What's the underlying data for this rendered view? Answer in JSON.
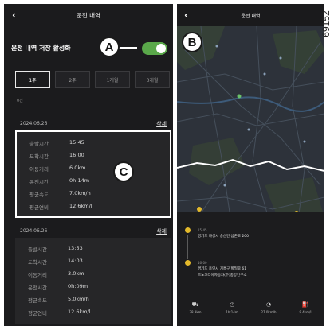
{
  "left": {
    "title": "운전 내역",
    "back_icon": "‹",
    "setting_label": "운전 내역 저장 활성화",
    "toggle_on": true,
    "toggle_color": "#5aa84a",
    "periods": [
      "1주",
      "2주",
      "1개월",
      "3개월"
    ],
    "selected_period": "1주",
    "note": "0건",
    "records": [
      {
        "date": "2024.06.26",
        "delete": "삭제",
        "rows": [
          {
            "k": "출발시간",
            "v": "15:45"
          },
          {
            "k": "도착시간",
            "v": "16:00"
          },
          {
            "k": "이동거리",
            "v": "6.0km"
          },
          {
            "k": "운전시간",
            "v": "0h:14m"
          },
          {
            "k": "평균속도",
            "v": "7.0km/h"
          },
          {
            "k": "평균연비",
            "v": "12.6km/l"
          }
        ]
      },
      {
        "date": "2024.06.26",
        "delete": "삭제",
        "rows": [
          {
            "k": "출발시간",
            "v": "13:53"
          },
          {
            "k": "도착시간",
            "v": "14:03"
          },
          {
            "k": "이동거리",
            "v": "3.0km"
          },
          {
            "k": "운전시간",
            "v": "0h:09m"
          },
          {
            "k": "평균속도",
            "v": "5.0km/h"
          },
          {
            "k": "평균연비",
            "v": "12.6km/l"
          }
        ]
      }
    ]
  },
  "right": {
    "title": "운전 내역",
    "back_icon": "‹",
    "stops": [
      {
        "time": "15:45",
        "addr": "경기도 화성시 송산면 삼존로 200",
        "addr2": ""
      },
      {
        "time": "16:00",
        "addr": "경기도 용인시 기흥구 할밀로 61",
        "addr2": "르노코리아자동차(주)중앙연구소"
      }
    ],
    "stats": [
      {
        "icon": "car-icon",
        "glyph": "⛟",
        "value": "78.3km"
      },
      {
        "icon": "clock-icon",
        "glyph": "◷",
        "value": "1h:14m"
      },
      {
        "icon": "speedometer-icon",
        "glyph": "◔",
        "value": "27.0km/h"
      },
      {
        "icon": "fuel-icon",
        "glyph": "⛽",
        "value": "9.4km/l"
      }
    ],
    "pin_color": "#e3b92b"
  },
  "callouts": {
    "a": "A",
    "b": "B",
    "c": "C"
  },
  "image_code": "69152"
}
